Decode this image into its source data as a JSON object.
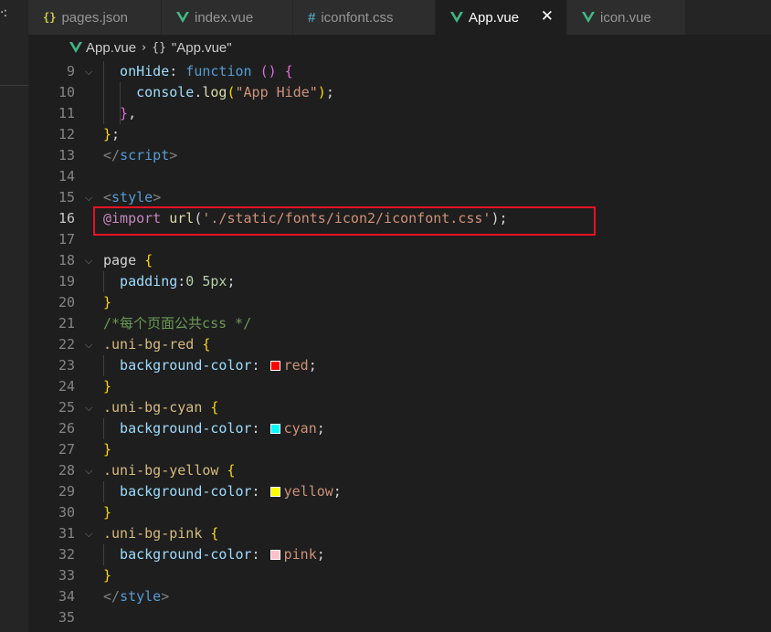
{
  "tabs": [
    {
      "label": "pages.json",
      "icon": "json-braces-icon",
      "glyph": "{}"
    },
    {
      "label": "index.vue",
      "icon": "vue-logo-icon"
    },
    {
      "label": "iconfont.css",
      "icon": "css-hash-icon",
      "glyph": "#"
    },
    {
      "label": "App.vue",
      "icon": "vue-logo-icon",
      "active": true,
      "close_glyph": "✕"
    },
    {
      "label": "icon.vue",
      "icon": "vue-logo-icon"
    }
  ],
  "breadcrumb": {
    "file": "App.vue",
    "separator": "›",
    "symbol_glyph": "{}",
    "symbol": "\"App.vue\""
  },
  "colors": {
    "accent_vue": "#41b883",
    "highlight_box": "#e81123",
    "swatch_red": "#ff0000",
    "swatch_cyan": "#00ffff",
    "swatch_yellow": "#ffff00",
    "swatch_pink": "#ffc0cb"
  },
  "editor": {
    "lines": [
      {
        "n": "9",
        "t": [
          [
            "onHide",
            "prop"
          ],
          [
            ": ",
            "plain"
          ],
          [
            "function",
            "kw"
          ],
          [
            " ",
            "plain"
          ],
          [
            "()",
            "br2"
          ],
          [
            " ",
            "plain"
          ],
          [
            "{",
            "br2"
          ]
        ]
      },
      {
        "n": "10",
        "t": [
          [
            "console",
            "prop"
          ],
          [
            ".",
            "plain"
          ],
          [
            "log",
            "fn"
          ],
          [
            "(",
            "br1"
          ],
          [
            "\"App Hide\"",
            "str"
          ],
          [
            ")",
            "br1"
          ],
          [
            ";",
            "plain"
          ]
        ]
      },
      {
        "n": "11",
        "t": [
          [
            "}",
            "br2"
          ],
          [
            ",",
            "plain"
          ]
        ]
      },
      {
        "n": "12",
        "t": [
          [
            "}",
            "br1"
          ],
          [
            ";",
            "plain"
          ]
        ]
      },
      {
        "n": "13",
        "t": [
          [
            "</",
            "tagpunct"
          ],
          [
            "script",
            "tag"
          ],
          [
            ">",
            "tagpunct"
          ]
        ]
      },
      {
        "n": "14",
        "t": []
      },
      {
        "n": "15",
        "t": [
          [
            "<",
            "tagpunct"
          ],
          [
            "style",
            "tag"
          ],
          [
            ">",
            "tagpunct"
          ]
        ]
      },
      {
        "n": "16",
        "t": [
          [
            "@import",
            "at"
          ],
          [
            " ",
            "plain"
          ],
          [
            "url",
            "fn"
          ],
          [
            "(",
            "plain"
          ],
          [
            "'./static/fonts/icon2/iconfont.css'",
            "str"
          ],
          [
            ")",
            "plain"
          ],
          [
            ";",
            "plain"
          ]
        ]
      },
      {
        "n": "17",
        "t": []
      },
      {
        "n": "18",
        "t": [
          [
            "page",
            "plain"
          ],
          [
            " ",
            "plain"
          ],
          [
            "{",
            "br1"
          ]
        ]
      },
      {
        "n": "19",
        "t": [
          [
            "padding",
            "prop"
          ],
          [
            ":",
            "plain"
          ],
          [
            "0",
            "num"
          ],
          [
            " ",
            "plain"
          ],
          [
            "5px",
            "num"
          ],
          [
            ";",
            "plain"
          ]
        ]
      },
      {
        "n": "20",
        "t": [
          [
            "}",
            "br1"
          ]
        ]
      },
      {
        "n": "21",
        "t": [
          [
            "/*每个页面公共css */",
            "cmt"
          ]
        ]
      },
      {
        "n": "22",
        "t": [
          [
            ".uni-bg-red",
            "sel"
          ],
          [
            " ",
            "plain"
          ],
          [
            "{",
            "br1"
          ]
        ]
      },
      {
        "n": "23",
        "t": [
          [
            "background-color",
            "prop"
          ],
          [
            ": ",
            "plain"
          ],
          [
            "red",
            "str"
          ],
          [
            ";",
            "plain"
          ]
        ],
        "swatch": "#ff0000"
      },
      {
        "n": "24",
        "t": [
          [
            "}",
            "br1"
          ]
        ]
      },
      {
        "n": "25",
        "t": [
          [
            ".uni-bg-cyan",
            "sel"
          ],
          [
            " ",
            "plain"
          ],
          [
            "{",
            "br1"
          ]
        ]
      },
      {
        "n": "26",
        "t": [
          [
            "background-color",
            "prop"
          ],
          [
            ": ",
            "plain"
          ],
          [
            "cyan",
            "str"
          ],
          [
            ";",
            "plain"
          ]
        ],
        "swatch": "#00ffff"
      },
      {
        "n": "27",
        "t": [
          [
            "}",
            "br1"
          ]
        ]
      },
      {
        "n": "28",
        "t": [
          [
            ".uni-bg-yellow",
            "sel"
          ],
          [
            " ",
            "plain"
          ],
          [
            "{",
            "br1"
          ]
        ]
      },
      {
        "n": "29",
        "t": [
          [
            "background-color",
            "prop"
          ],
          [
            ": ",
            "plain"
          ],
          [
            "yellow",
            "str"
          ],
          [
            ";",
            "plain"
          ]
        ],
        "swatch": "#ffff00"
      },
      {
        "n": "30",
        "t": [
          [
            "}",
            "br1"
          ]
        ]
      },
      {
        "n": "31",
        "t": [
          [
            ".uni-bg-pink",
            "sel"
          ],
          [
            " ",
            "plain"
          ],
          [
            "{",
            "br1"
          ]
        ]
      },
      {
        "n": "32",
        "t": [
          [
            "background-color",
            "prop"
          ],
          [
            ": ",
            "plain"
          ],
          [
            "pink",
            "str"
          ],
          [
            ";",
            "plain"
          ]
        ],
        "swatch": "#ffc0cb"
      },
      {
        "n": "33",
        "t": [
          [
            "}",
            "br1"
          ]
        ]
      },
      {
        "n": "34",
        "t": [
          [
            "</",
            "tagpunct"
          ],
          [
            "style",
            "tag"
          ],
          [
            ">",
            "tagpunct"
          ]
        ]
      },
      {
        "n": "35",
        "t": []
      }
    ]
  }
}
